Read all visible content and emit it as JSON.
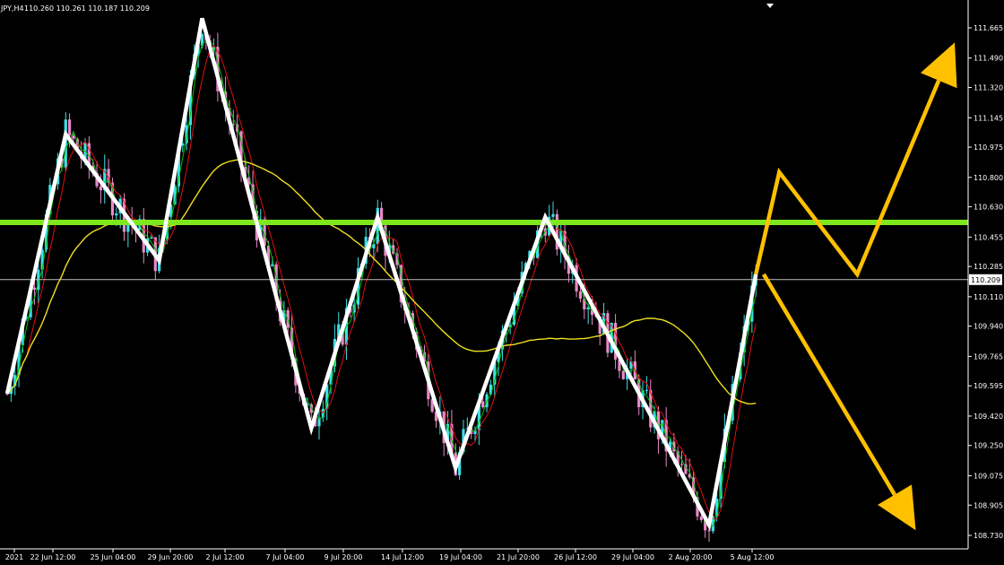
{
  "header": {
    "symbol": "JPY,H4",
    "ohlc": "110.260 110.261 110.187 110.209"
  },
  "colors": {
    "background": "#000000",
    "axis": "#ffffff",
    "bull_candle": "#3ee0e8",
    "bear_candle": "#e88ac8",
    "ma_fast": "#00c000",
    "ma_mid": "#e01010",
    "ma_slow": "#f0e020",
    "zigzag": "#ffffff",
    "resistance": "#7ee81e",
    "projection": "#ffc000",
    "current_price_line": "#c0c0c0"
  },
  "chart_data": {
    "type": "line",
    "title": "",
    "xlabel": "",
    "ylabel": "",
    "ylim": [
      108.66,
      111.76
    ],
    "y_ticks": [
      "111.665",
      "111.490",
      "111.320",
      "111.145",
      "110.975",
      "110.800",
      "110.630",
      "110.455",
      "110.285",
      "110.110",
      "109.940",
      "109.765",
      "109.595",
      "109.420",
      "109.250",
      "109.075",
      "108.905",
      "108.730"
    ],
    "x_ticks": [
      "2021",
      "22 Jun 12:00",
      "25 Jun 04:00",
      "29 Jun 20:00",
      "2 Jul 12:00",
      "7 Jul 04:00",
      "9 Jul 20:00",
      "14 Jul 12:00",
      "19 Jul 04:00",
      "21 Jul 20:00",
      "26 Jul 12:00",
      "29 Jul 04:00",
      "2 Aug 20:00",
      "5 Aug 12:00"
    ],
    "current_price": 110.209,
    "current_price_label": "110.209",
    "resistance_level": 110.54,
    "zigzag": [
      {
        "bar": 0,
        "price": 109.55
      },
      {
        "bar": 15,
        "price": 111.05
      },
      {
        "bar": 39,
        "price": 110.32
      },
      {
        "bar": 50,
        "price": 111.72
      },
      {
        "bar": 78,
        "price": 109.35
      },
      {
        "bar": 95,
        "price": 110.57
      },
      {
        "bar": 115,
        "price": 109.12
      },
      {
        "bar": 138,
        "price": 110.57
      },
      {
        "bar": 180,
        "price": 108.79
      },
      {
        "bar": 192,
        "price": 110.24
      }
    ],
    "projection_up": [
      {
        "bar": 192,
        "price": 110.24
      },
      {
        "bar": 198,
        "price": 110.83
      },
      {
        "bar": 218,
        "price": 110.24
      },
      {
        "bar": 243,
        "price": 111.58
      }
    ],
    "projection_down": [
      {
        "bar": 194,
        "price": 110.24
      },
      {
        "bar": 233,
        "price": 108.76
      }
    ]
  }
}
